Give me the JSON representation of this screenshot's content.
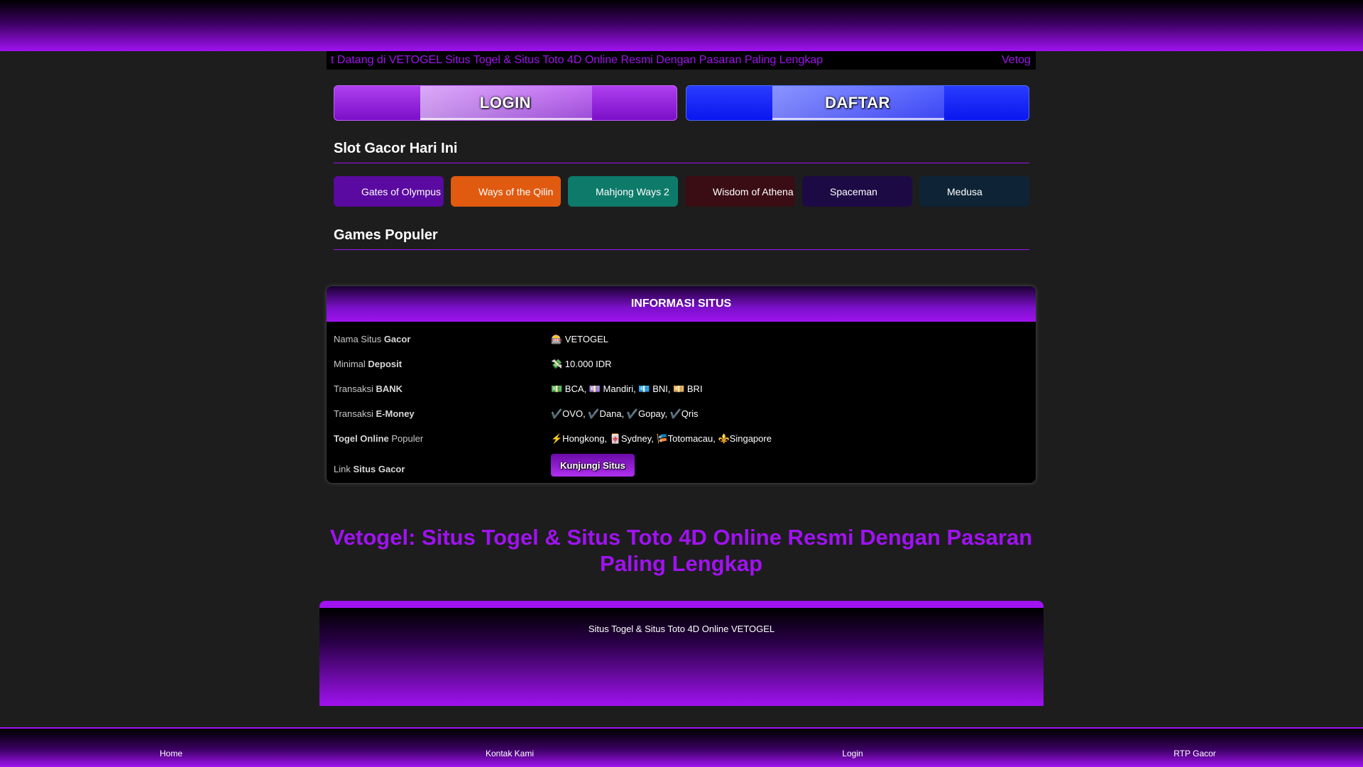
{
  "marquee": {
    "text": "t Datang di VETOGEL Situs Togel & Situs Toto 4D Online Resmi Dengan Pasaran Paling Lengkap",
    "text_repeat": "Vetog"
  },
  "auth": {
    "login_label": "LOGIN",
    "daftar_label": "DAFTAR"
  },
  "slot_section": {
    "title": "Slot Gacor Hari Ini",
    "items": [
      {
        "label": "Gates of Olympus",
        "color": "#5a0aa0"
      },
      {
        "label": "Ways of the Qilin",
        "color": "#e05a10"
      },
      {
        "label": "Mahjong Ways 2",
        "color": "#0e7a6a"
      },
      {
        "label": "Wisdom of Athena",
        "color": "#3a0c14"
      },
      {
        "label": "Spaceman",
        "color": "#1c0a44"
      },
      {
        "label": "Medusa",
        "color": "#0e2436"
      }
    ]
  },
  "games_section": {
    "title": "Games Populer"
  },
  "info": {
    "title": "INFORMASI SITUS",
    "rows": [
      {
        "label_plain": "Nama Situs ",
        "label_bold": "Gacor",
        "value": "🎰 VETOGEL"
      },
      {
        "label_plain": "Minimal ",
        "label_bold": "Deposit",
        "value": "💸 10.000 IDR"
      },
      {
        "label_plain": "Transaksi ",
        "label_bold": "BANK",
        "value": "💵 BCA, 💷 Mandiri, 💶 BNI, 💴 BRI"
      },
      {
        "label_plain": "Transaksi ",
        "label_bold": "E-Money",
        "value": "✔️OVO, ✔️Dana, ✔️Gopay, ✔️Qris"
      },
      {
        "label_bold": "Togel Online",
        "label_plain": " Populer",
        "value": "⚡Hongkong, 🀄Sydney, 🎏Totomacau, ⚜️Singapore"
      },
      {
        "label_plain": "Link ",
        "label_bold": "Situs Gacor",
        "button": "Kunjungi Situs"
      }
    ]
  },
  "main_heading": "Vetogel: Situs Togel & Situs Toto 4D Online Resmi Dengan Pasaran Paling Lengkap",
  "footer": {
    "text": "Situs Togel & Situs Toto 4D Online VETOGEL"
  },
  "bottom_nav": [
    {
      "label": "Home"
    },
    {
      "label": "Kontak Kami"
    },
    {
      "label": "Login"
    },
    {
      "label": "RTP Gacor"
    }
  ],
  "colors": {
    "accent": "#a012f0",
    "daftar_blue": "#0a16ee",
    "background": "#1d1d1d"
  }
}
